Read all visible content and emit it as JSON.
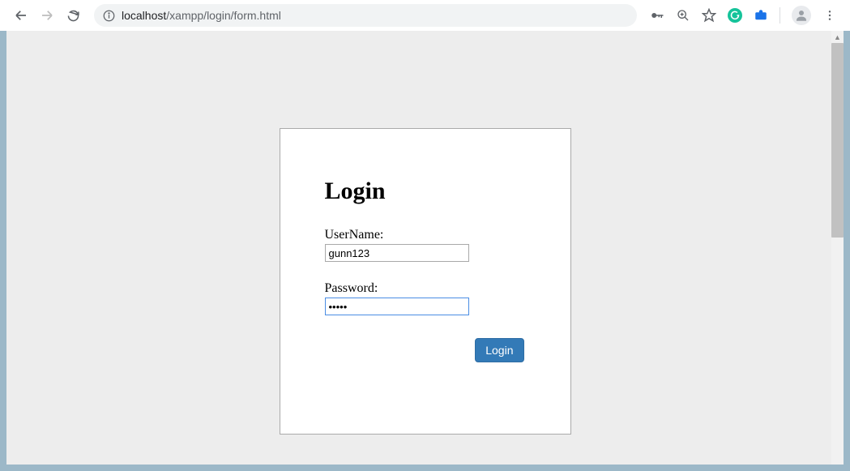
{
  "browser": {
    "url_host": "localhost",
    "url_path": "/xampp/login/form.html"
  },
  "login_form": {
    "title": "Login",
    "username_label": "UserName:",
    "username_value": "gunn123",
    "password_label": "Password:",
    "password_value": "•••••",
    "submit_label": "Login"
  }
}
